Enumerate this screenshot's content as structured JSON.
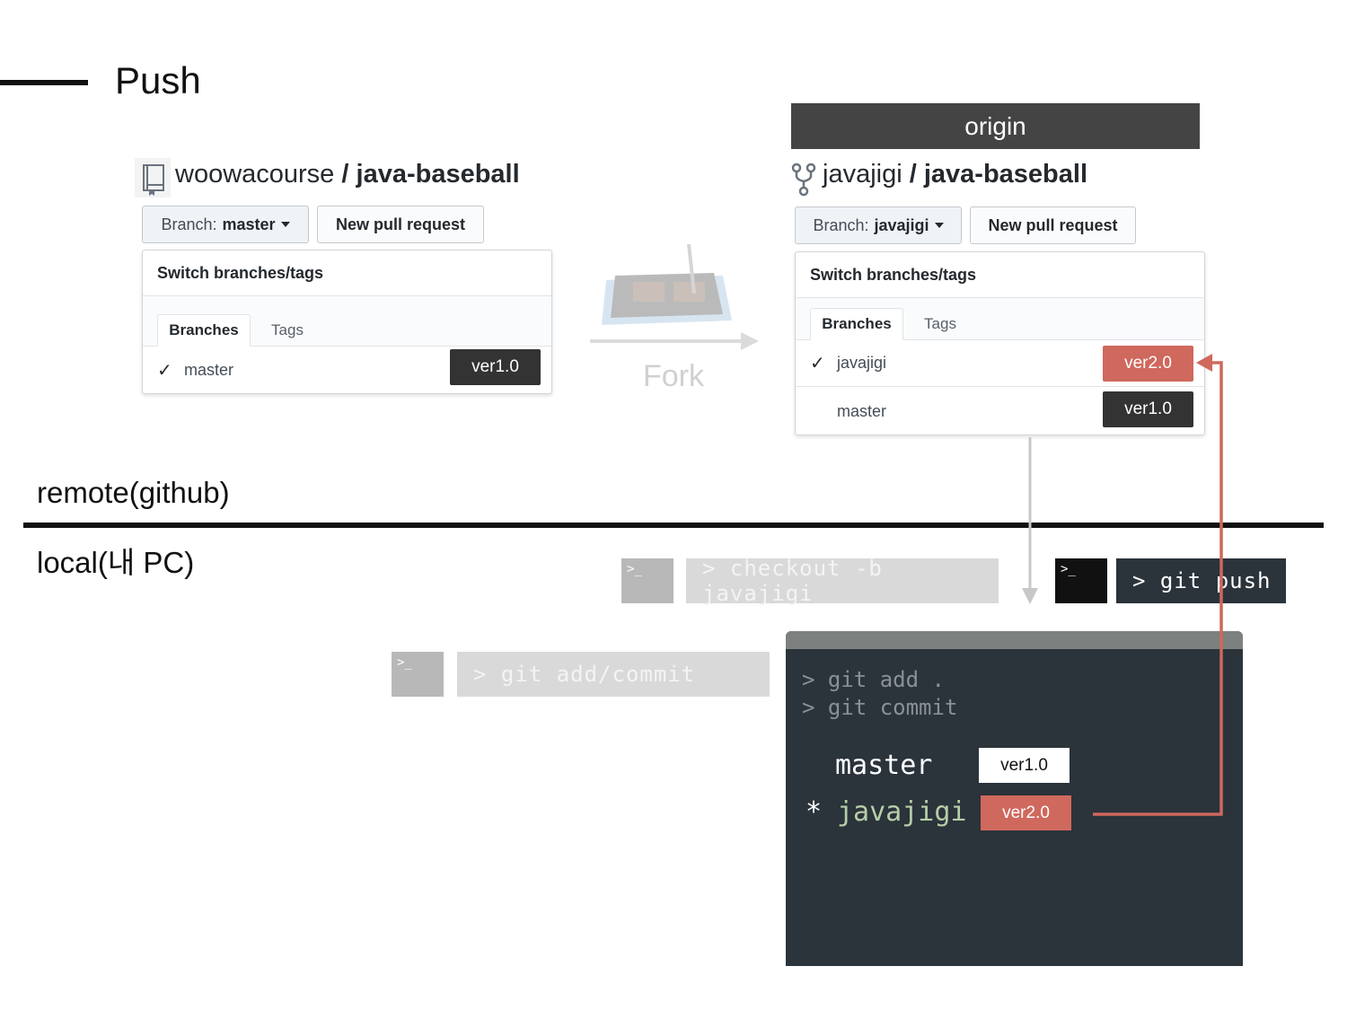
{
  "title": "Push",
  "left_repo": {
    "owner": "woowacourse",
    "separator": "/",
    "name": "java-baseball",
    "branch_prefix": "Branch:",
    "branch_value": "master",
    "new_pr_label": "New pull request",
    "panel_title": "Switch branches/tags",
    "tabs": [
      "Branches",
      "Tags"
    ],
    "branches": [
      {
        "name": "master",
        "checked": true,
        "version": "ver1.0",
        "version_color": "#333333"
      }
    ]
  },
  "fork_label": "Fork",
  "origin_label": "origin",
  "right_repo": {
    "owner": "javajigi",
    "separator": "/",
    "name": "java-baseball",
    "branch_prefix": "Branch:",
    "branch_value": "javajigi",
    "new_pr_label": "New pull request",
    "panel_title": "Switch branches/tags",
    "tabs": [
      "Branches",
      "Tags"
    ],
    "branches": [
      {
        "name": "javajigi",
        "checked": true,
        "version": "ver2.0",
        "version_color": "#cf685d"
      },
      {
        "name": "master",
        "checked": false,
        "version": "ver1.0",
        "version_color": "#333333"
      }
    ]
  },
  "remote_label": "remote(github)",
  "local_label": "local(내 PC)",
  "commands": {
    "add_commit": "> git add/commit",
    "checkout": "> checkout -b javajigi",
    "push": "> git push",
    "prompt_icon": ">_"
  },
  "terminal": {
    "lines": [
      "> git add .",
      "> git commit"
    ],
    "branches": [
      {
        "marker": "",
        "name": "master",
        "version": "ver1.0",
        "current": false
      },
      {
        "marker": "*",
        "name": "javajigi",
        "version": "ver2.0",
        "current": true
      }
    ]
  },
  "colors": {
    "accent_red": "#cf685d",
    "dark_badge": "#333333",
    "terminal_bg": "#2b333b",
    "current_branch_green": "#b5cea8"
  }
}
